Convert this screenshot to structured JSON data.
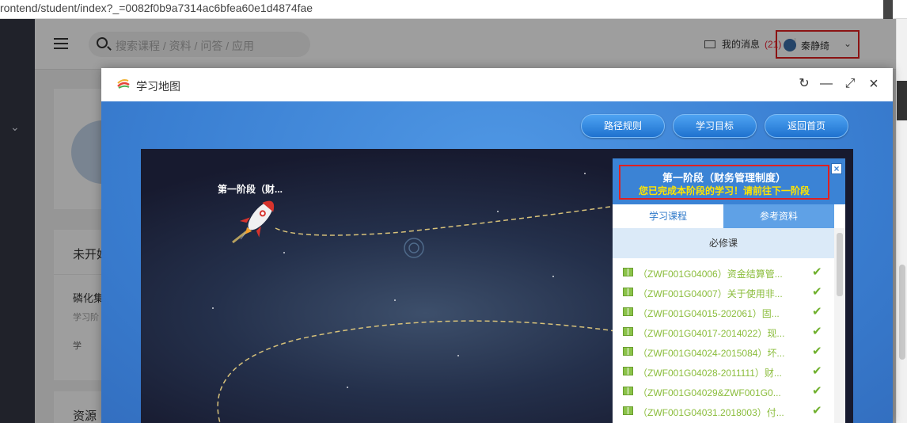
{
  "browser": {
    "url": "rontend/student/index?_=0082f0b9a7314ac6bfea60e1d4874fae"
  },
  "header": {
    "search_placeholder": "搜索课程 / 资料 / 问答 / 应用",
    "messages_label": "我的消息",
    "messages_count": "(21)",
    "user_name": "秦静绮"
  },
  "background_cards": {
    "card2_heading": "未开始",
    "card2_item_title": "磷化集",
    "card2_item_sub": "学习阶",
    "card2_item_link": "学",
    "card3_heading": "资源"
  },
  "modal": {
    "title": "学习地图",
    "buttons": {
      "route": "路径规则",
      "goal": "学习目标",
      "home": "返回首页"
    },
    "stage_label": "第一阶段（财..."
  },
  "panel": {
    "title": "第一阶段（财务管理制度）",
    "subtitle": "您已完成本阶段的学习！请前往下一阶段",
    "close": "×",
    "tabs": [
      "学习课程",
      "参考资料"
    ],
    "section": "必修课",
    "items": [
      "（ZWF001G04006）资金结算管...",
      "（ZWF001G04007）关于使用非...",
      "（ZWF001G04015-202061）固...",
      "（ZWF001G04017-2014022）现...",
      "（ZWF001G04024-2015084）坏...",
      "（ZWF001G04028-2011111）财...",
      "（ZWF001G04029&ZWF001G0...",
      "（ZWF001G04031.2018003）付..."
    ]
  },
  "colors": {
    "accent": "#3b83d5",
    "highlight": "#e02020",
    "done": "#8bbd3c"
  }
}
